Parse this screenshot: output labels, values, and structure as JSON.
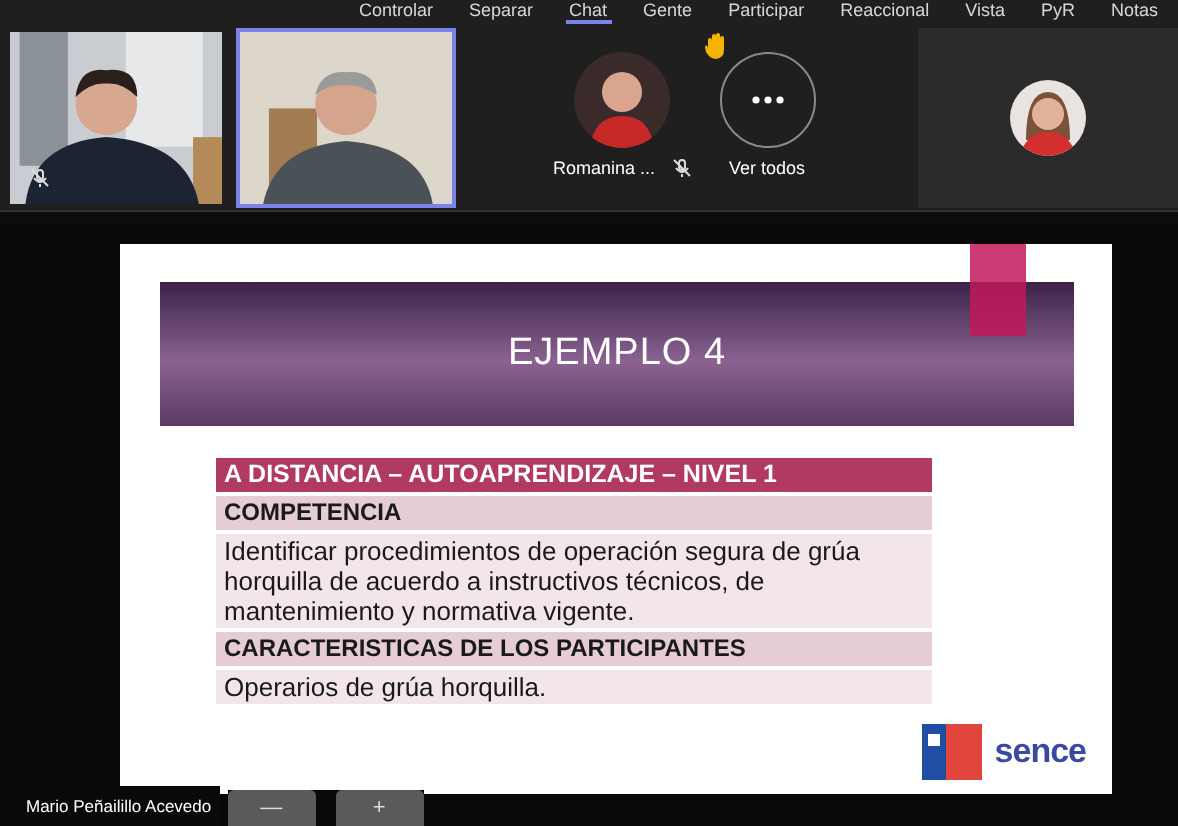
{
  "menu": [
    {
      "label": "Controlar",
      "selected": false
    },
    {
      "label": "Separar",
      "selected": false
    },
    {
      "label": "Chat",
      "selected": true
    },
    {
      "label": "Gente",
      "selected": false
    },
    {
      "label": "Participar",
      "selected": false
    },
    {
      "label": "Reaccional",
      "selected": false
    },
    {
      "label": "Vista",
      "selected": false
    },
    {
      "label": "PyR",
      "selected": false
    },
    {
      "label": "Notas",
      "selected": false
    }
  ],
  "videos": [
    {
      "kind": "office",
      "muted": true,
      "selected": false
    },
    {
      "kind": "room",
      "muted": false,
      "selected": true
    }
  ],
  "gallery": {
    "person": {
      "name": "Romanina ...",
      "muted": true
    },
    "more": {
      "label": "Ver todos",
      "hand_raised": true
    }
  },
  "slide": {
    "title": "EJEMPLO 4",
    "rows": [
      {
        "kind": "header",
        "text": "A DISTANCIA – AUTOAPRENDIZAJE – NIVEL 1"
      },
      {
        "kind": "section",
        "text": "COMPETENCIA"
      },
      {
        "kind": "body",
        "text": "Identificar procedimientos de operación segura de grúa horquilla de acuerdo a instructivos técnicos, de mantenimiento y normativa vigente."
      },
      {
        "kind": "section",
        "text": "CARACTERISTICAS DE LOS PARTICIPANTES"
      },
      {
        "kind": "body",
        "text": "Operarios de grúa horquilla."
      }
    ],
    "logo": "sence"
  },
  "presenter": {
    "name": "Mario Peñailillo Acevedo"
  },
  "zoom_controls": [
    "—",
    "+"
  ]
}
